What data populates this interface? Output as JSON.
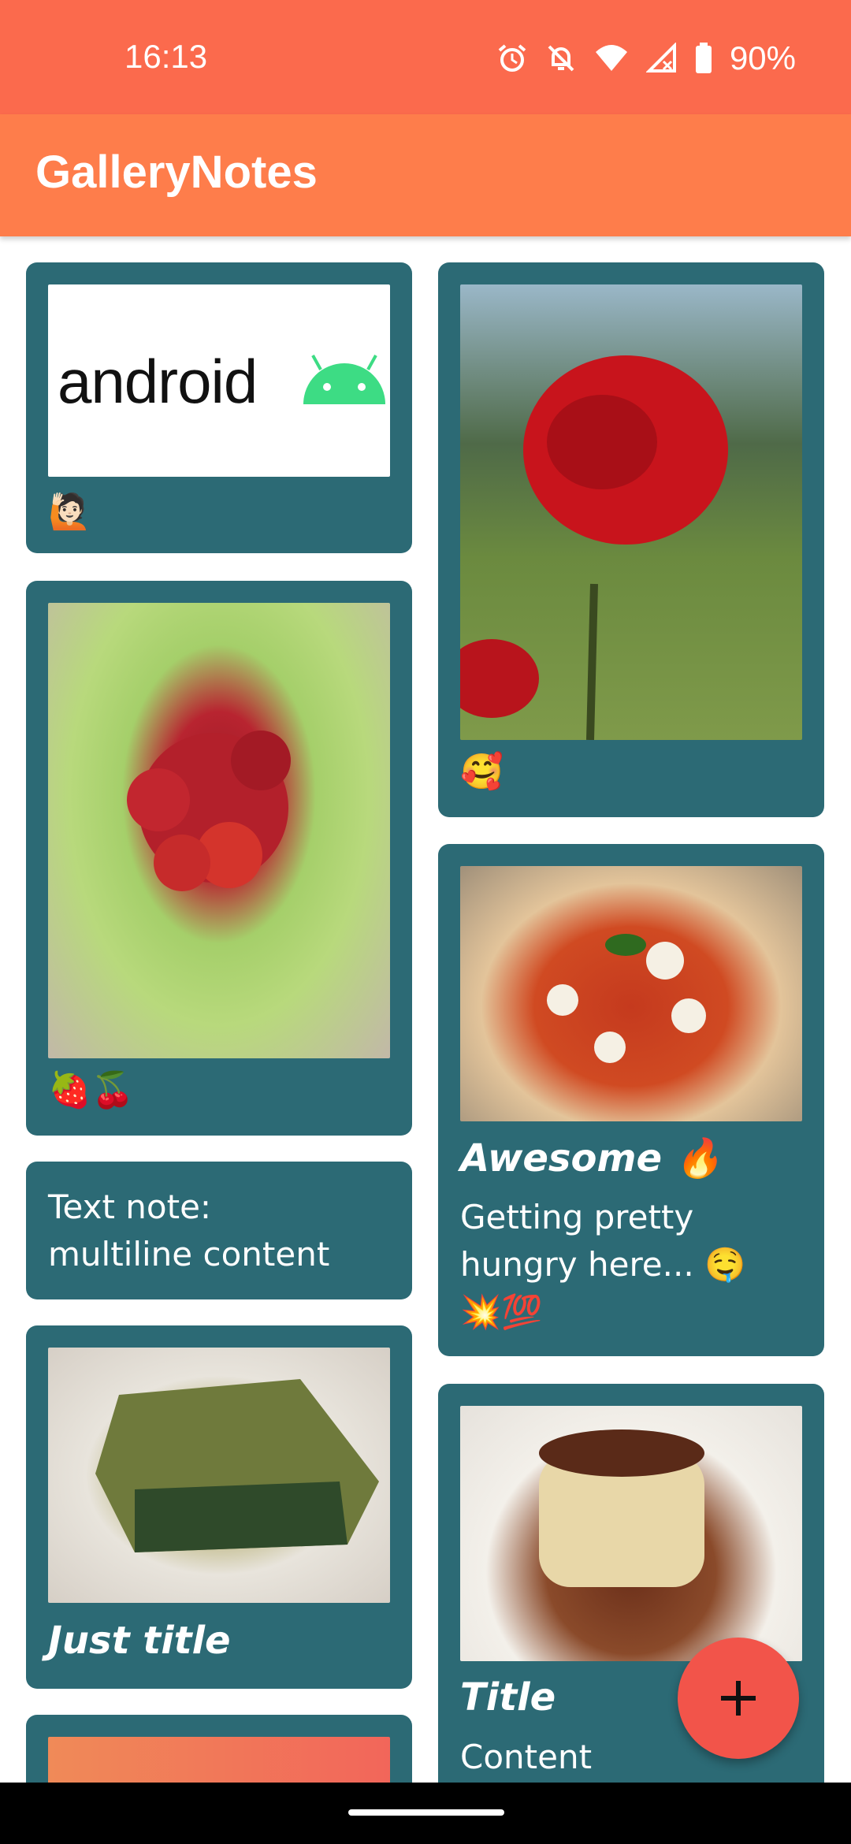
{
  "status": {
    "time": "16:13",
    "battery": "90%"
  },
  "appbar": {
    "title": "GalleryNotes"
  },
  "notes": {
    "android": {
      "image_text": "android",
      "emoji": "🙋🏻"
    },
    "rose": {
      "emoji": "🥰"
    },
    "berries": {
      "emoji": "🍓🍒"
    },
    "pizza": {
      "title": "Awesome 🔥",
      "content_line1": "Getting pretty",
      "content_line2": "hungry here... 🤤",
      "content_line3": "💥💯"
    },
    "text": {
      "content_line1": "Text note:",
      "content_line2": "multiline content"
    },
    "lasagna": {
      "title": "Just title"
    },
    "tiramisu": {
      "title": "Title",
      "content": "Content"
    }
  },
  "colors": {
    "status_bar": "#fb6a4d",
    "app_bar": "#fe7d4b",
    "card": "#2c6a75",
    "fab": "#f2544a"
  },
  "fab": {
    "icon": "plus-icon"
  }
}
